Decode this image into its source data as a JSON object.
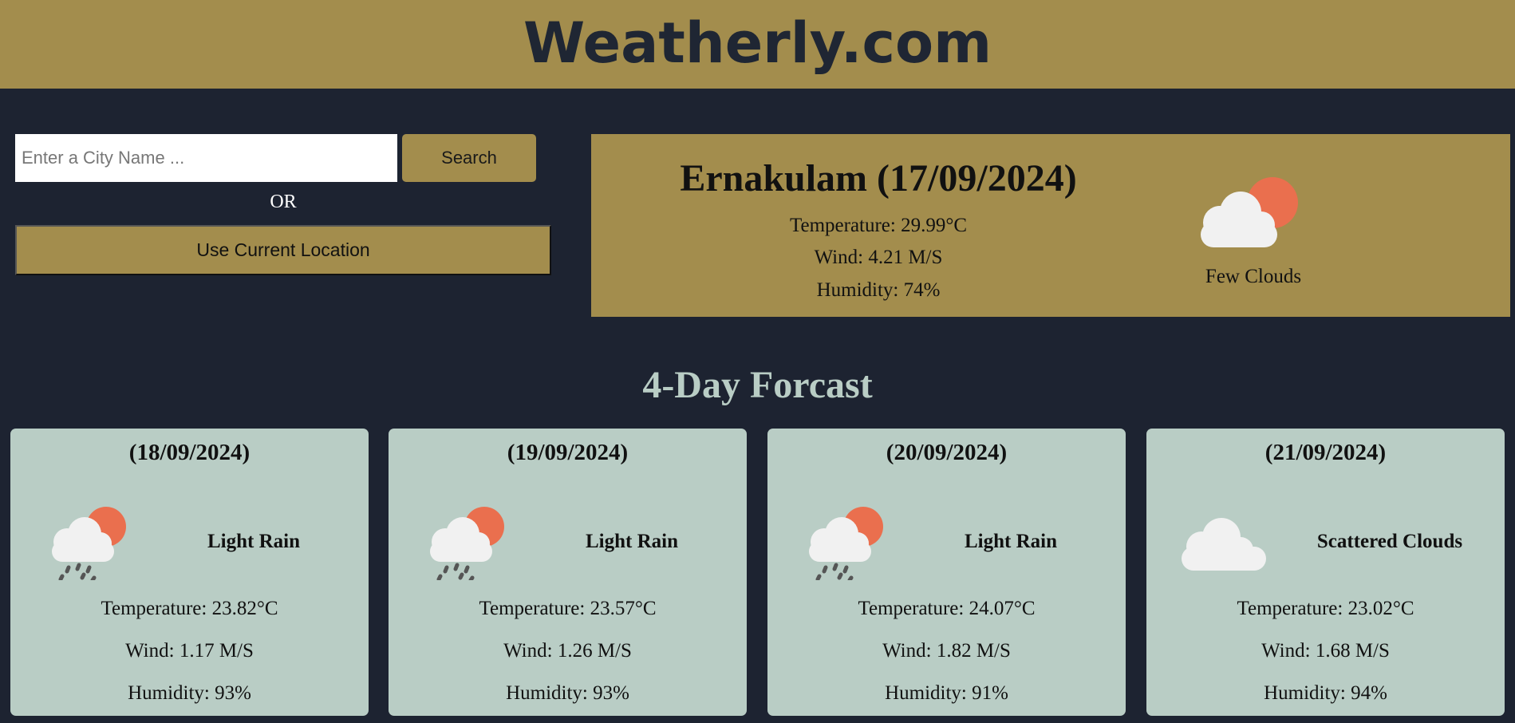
{
  "header": {
    "title": "Weatherly.com"
  },
  "search": {
    "placeholder": "Enter a City Name ...",
    "button_label": "Search",
    "or_label": "OR",
    "location_button_label": "Use Current Location"
  },
  "current": {
    "title": "Ernakulam (17/09/2024)",
    "temperature": "Temperature: 29.99°C",
    "wind": "Wind: 4.21 M/S",
    "humidity": "Humidity: 74%",
    "description": "Few Clouds",
    "icon": "few-clouds-icon"
  },
  "forecast": {
    "heading": "4-Day Forcast",
    "days": [
      {
        "date": "(18/09/2024)",
        "description": "Light Rain",
        "temperature": "Temperature: 23.82°C",
        "wind": "Wind: 1.17 M/S",
        "humidity": "Humidity: 93%",
        "icon": "light-rain-icon"
      },
      {
        "date": "(19/09/2024)",
        "description": "Light Rain",
        "temperature": "Temperature: 23.57°C",
        "wind": "Wind: 1.26 M/S",
        "humidity": "Humidity: 93%",
        "icon": "light-rain-icon"
      },
      {
        "date": "(20/09/2024)",
        "description": "Light Rain",
        "temperature": "Temperature: 24.07°C",
        "wind": "Wind: 1.82 M/S",
        "humidity": "Humidity: 91%",
        "icon": "light-rain-icon"
      },
      {
        "date": "(21/09/2024)",
        "description": "Scattered Clouds",
        "temperature": "Temperature: 23.02°C",
        "wind": "Wind: 1.68 M/S",
        "humidity": "Humidity: 94%",
        "icon": "scattered-clouds-icon"
      }
    ]
  },
  "colors": {
    "background": "#1d2331",
    "accent": "#a38d4d",
    "card": "#b9cdc5",
    "sun": "#ea6f4e",
    "cloud": "#f1f1f1"
  }
}
